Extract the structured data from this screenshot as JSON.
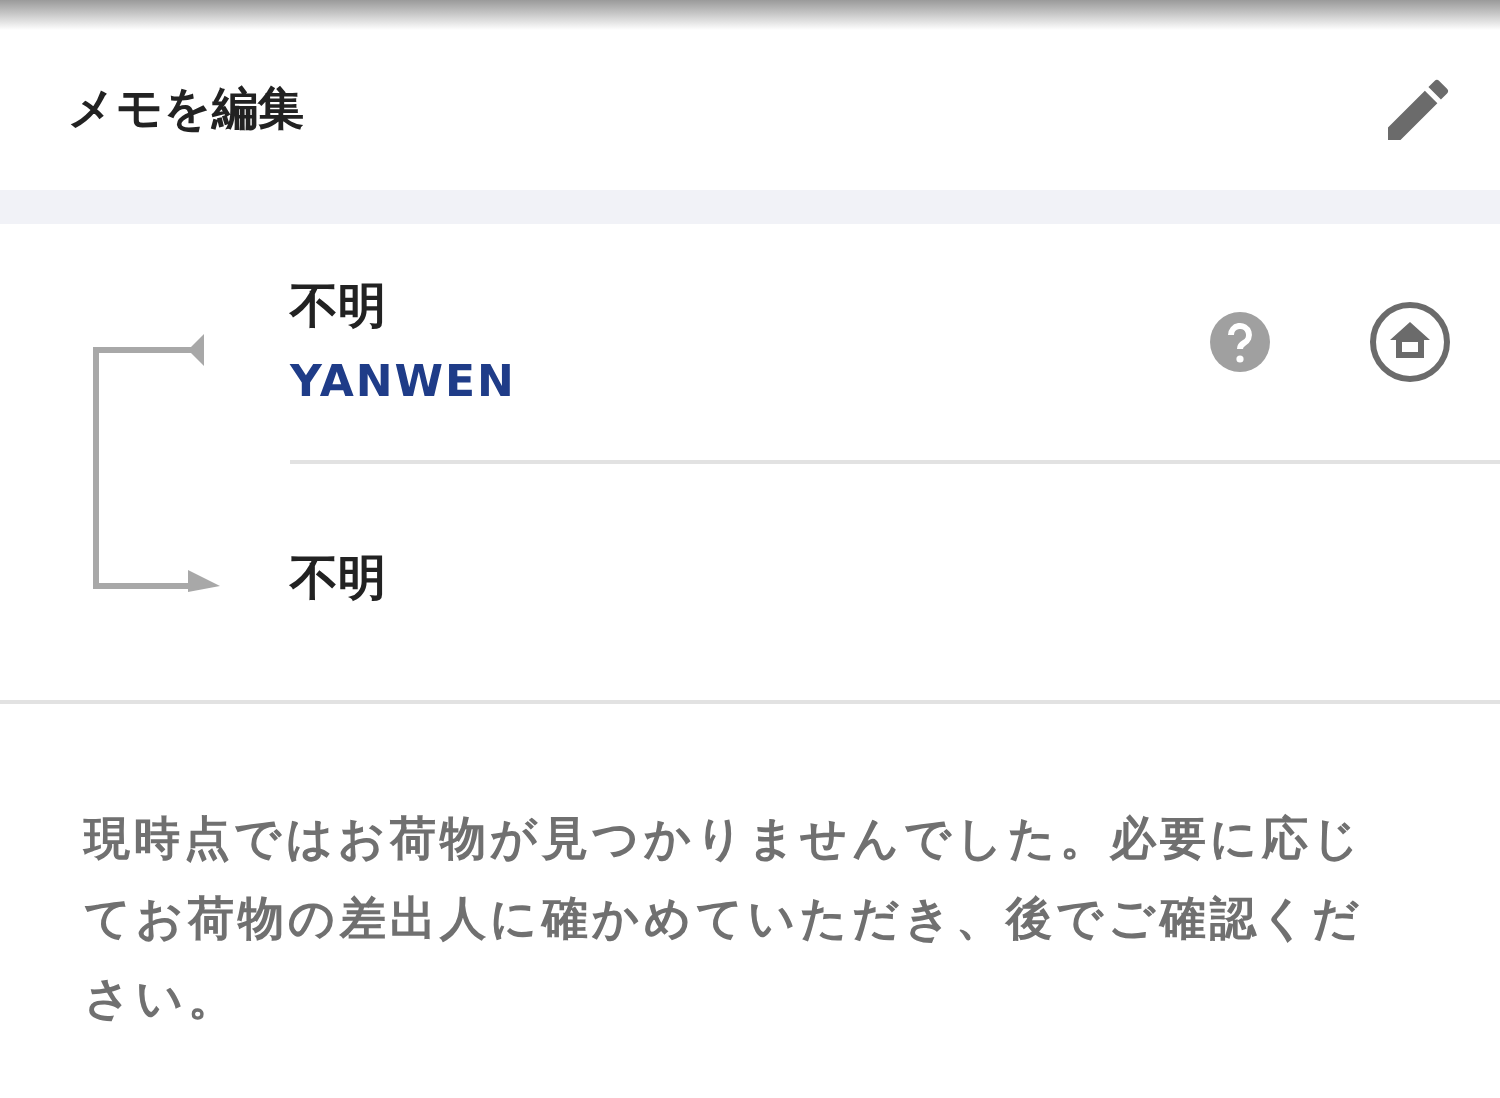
{
  "header": {
    "title": "メモを編集"
  },
  "route": {
    "origin": {
      "name": "不明",
      "carrier": "YANWEN"
    },
    "destination": {
      "name": "不明"
    }
  },
  "message": "現時点ではお荷物が見つかりませんでした。必要に応じてお荷物の差出人に確かめていただき、後でご確認ください。"
}
